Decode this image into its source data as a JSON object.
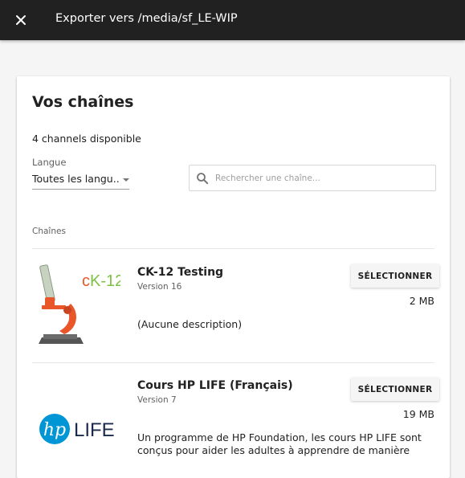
{
  "appbar": {
    "title": "Exporter vers /media/sf_LE-WIP",
    "close_icon": "close-icon"
  },
  "card": {
    "title": "Vos chaînes",
    "count_text": "4 channels disponible",
    "language_filter": {
      "label": "Langue",
      "selected": "Toutes les langu..."
    },
    "search": {
      "placeholder": "Rechercher une chaîne...",
      "value": "",
      "icon": "search-icon"
    },
    "section_label": "Chaînes"
  },
  "channels": [
    {
      "name": "CK-12 Testing",
      "version": "Version 16",
      "size": "2 MB",
      "description": "(Aucune description)",
      "select_label": "SÉLECTIONNER",
      "thumbnail_text": "cK-12",
      "thumbnail_icon": "microscope-logo"
    },
    {
      "name": "Cours HP LIFE (Français)",
      "version": "Version 7",
      "size": "19 MB",
      "description": "Un programme de HP Foundation, les cours HP LIFE sont conçus pour aider les adultes à apprendre de manière",
      "select_label": "SÉLECTIONNER",
      "thumbnail_text": "LIFE",
      "thumbnail_icon": "hp-logo"
    }
  ],
  "colors": {
    "appbar": "#212121",
    "background": "#f5f5f5",
    "card": "#ffffff",
    "hp_blue": "#0096d6",
    "ck12_orange": "#e8562a",
    "ck12_green": "#7cc242"
  }
}
